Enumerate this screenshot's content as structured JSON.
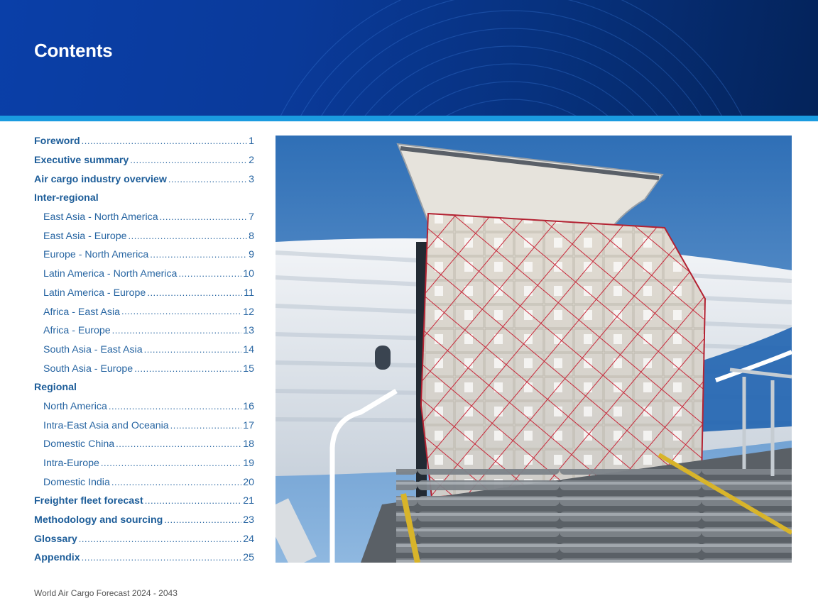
{
  "page": {
    "title": "Contents",
    "footer": "World Air Cargo Forecast 2024 - 2043"
  },
  "toc": [
    {
      "label": "Foreword",
      "page": "1",
      "level": "main"
    },
    {
      "label": "Executive summary",
      "page": "2",
      "level": "main"
    },
    {
      "label": "Air cargo industry overview",
      "page": "3",
      "level": "main"
    },
    {
      "label": "Inter-regional",
      "page": "",
      "level": "heading"
    },
    {
      "label": "East Asia - North America ",
      "page": "7",
      "level": "sub"
    },
    {
      "label": "East Asia - Europe",
      "page": "8",
      "level": "sub"
    },
    {
      "label": "Europe - North America",
      "page": "9",
      "level": "sub"
    },
    {
      "label": "Latin America - North America",
      "page": "10",
      "level": "sub"
    },
    {
      "label": "Latin America - Europe",
      "page": "11",
      "level": "sub"
    },
    {
      "label": "Africa - East Asia",
      "page": "12",
      "level": "sub"
    },
    {
      "label": "Africa - Europe ",
      "page": "13",
      "level": "sub"
    },
    {
      "label": "South Asia - East Asia",
      "page": "14",
      "level": "sub"
    },
    {
      "label": "South Asia - Europe ",
      "page": "15",
      "level": "sub"
    },
    {
      "label": "Regional",
      "page": "",
      "level": "heading"
    },
    {
      "label": "North America",
      "page": "16",
      "level": "sub"
    },
    {
      "label": "Intra-East Asia and Oceania ",
      "page": "17",
      "level": "sub"
    },
    {
      "label": "Domestic China",
      "page": "18",
      "level": "sub"
    },
    {
      "label": "Intra-Europe ",
      "page": "19",
      "level": "sub"
    },
    {
      "label": "Domestic India  ",
      "page": "20",
      "level": "sub"
    },
    {
      "label": "Freighter fleet forecast ",
      "page": "21",
      "level": "main"
    },
    {
      "label": "Methodology and sourcing",
      "page": "23",
      "level": "main"
    },
    {
      "label": "Glossary ",
      "page": "24",
      "level": "main"
    },
    {
      "label": "Appendix ",
      "page": "25",
      "level": "main"
    }
  ],
  "colors": {
    "banner": "#0a3a9a",
    "stripe": "#1a9be0",
    "toc_text": "#1d5d99"
  },
  "image": {
    "subject": "cargo pallet with red net being loaded through freighter aircraft side door"
  }
}
